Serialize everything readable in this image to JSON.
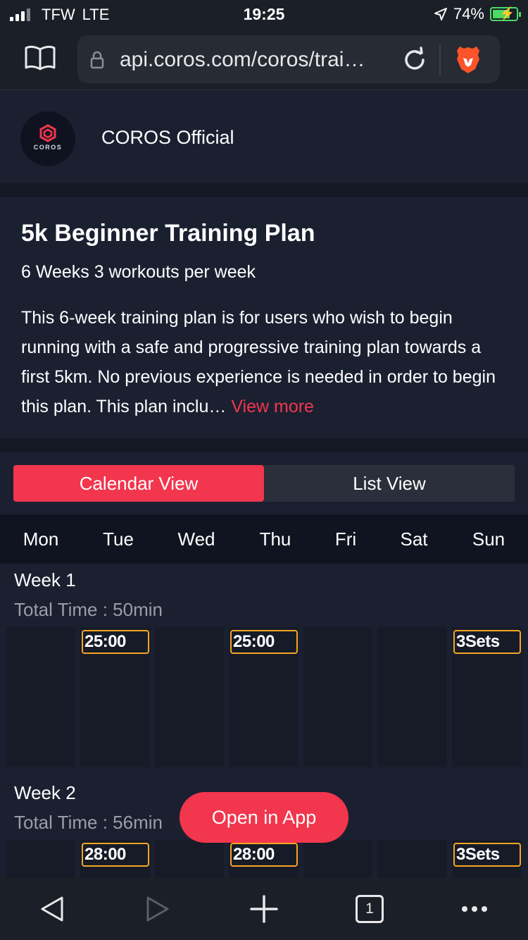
{
  "status_bar": {
    "carrier": "TFW",
    "network": "LTE",
    "time": "19:25",
    "battery_percent": "74%",
    "battery_level": 0.74
  },
  "browser": {
    "url": "api.coros.com/coros/trai…"
  },
  "publisher": {
    "logo_text": "COROS",
    "name": "COROS Official"
  },
  "plan": {
    "title": "5k Beginner Training Plan",
    "subtitle": "6 Weeks 3 workouts per week",
    "description": "This 6-week training plan is for users who wish to begin running with a safe and progressive training plan towards a first 5km. No previous experience is needed in order to begin this plan. This plan inclu…",
    "view_more": "View more"
  },
  "views": {
    "calendar": "Calendar View",
    "list": "List View"
  },
  "days": [
    "Mon",
    "Tue",
    "Wed",
    "Thu",
    "Fri",
    "Sat",
    "Sun"
  ],
  "weeks": [
    {
      "title": "Week 1",
      "total": "Total Time : 50min",
      "workouts": [
        "",
        "25:00",
        "",
        "25:00",
        "",
        "",
        "3Sets"
      ]
    },
    {
      "title": "Week 2",
      "total": "Total Time : 56min",
      "workouts": [
        "",
        "28:00",
        "",
        "28:00",
        "",
        "",
        "3Sets"
      ]
    }
  ],
  "open_in_app": "Open in App",
  "toolbar": {
    "tab_count": "1"
  },
  "colors": {
    "accent": "#f2364d",
    "workout_border": "#f5a623",
    "battery": "#4cd964"
  }
}
